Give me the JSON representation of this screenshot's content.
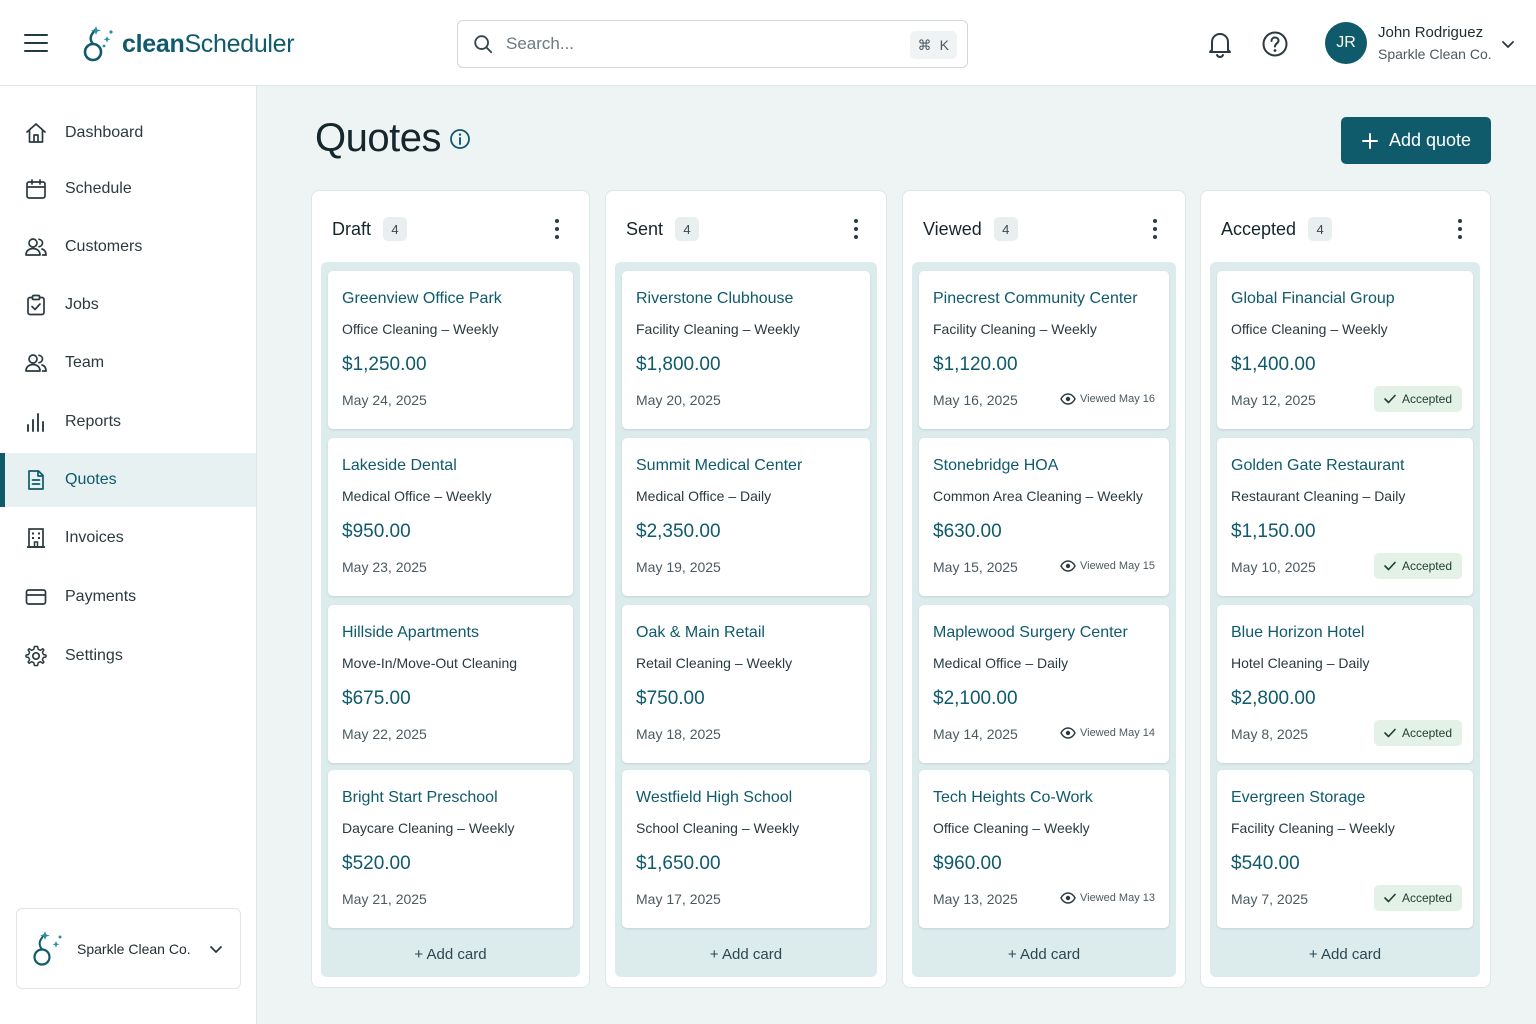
{
  "header": {
    "brand_prefix": "clean",
    "brand_suffix": "Scheduler",
    "search_placeholder": "Search...",
    "search_shortcut_symbol": "⌘",
    "search_shortcut_key": "K",
    "user_initials": "JR",
    "user_name": "John Rodriguez",
    "user_org": "Sparkle Clean Co."
  },
  "sidebar": {
    "items": [
      {
        "label": "Dashboard",
        "icon": "home-icon"
      },
      {
        "label": "Schedule",
        "icon": "calendar-icon"
      },
      {
        "label": "Customers",
        "icon": "users-icon"
      },
      {
        "label": "Jobs",
        "icon": "clipboard-check-icon"
      },
      {
        "label": "Team",
        "icon": "team-icon"
      },
      {
        "label": "Reports",
        "icon": "bar-chart-icon"
      },
      {
        "label": "Quotes",
        "icon": "document-icon",
        "active": true
      },
      {
        "label": "Invoices",
        "icon": "building-icon"
      },
      {
        "label": "Payments",
        "icon": "credit-card-icon"
      },
      {
        "label": "Settings",
        "icon": "gear-icon"
      }
    ],
    "org_switcher": "Sparkle Clean Co."
  },
  "main": {
    "title": "Quotes",
    "add_quote_label": "Add quote",
    "add_card_label": "+ Add card",
    "columns": [
      {
        "title": "Draft",
        "count": "4",
        "cards": [
          {
            "title": "Greenview Office Park",
            "subtitle": "Office Cleaning – Weekly",
            "price": "$1,250.00",
            "date": "May 24, 2025"
          },
          {
            "title": "Lakeside Dental",
            "subtitle": "Medical Office – Weekly",
            "price": "$950.00",
            "date": "May 23, 2025"
          },
          {
            "title": "Hillside Apartments",
            "subtitle": "Move-In/Move-Out Cleaning",
            "price": "$675.00",
            "date": "May 22, 2025"
          },
          {
            "title": "Bright Start Preschool",
            "subtitle": "Daycare Cleaning – Weekly",
            "price": "$520.00",
            "date": "May 21, 2025"
          }
        ]
      },
      {
        "title": "Sent",
        "count": "4",
        "cards": [
          {
            "title": "Riverstone Clubhouse",
            "subtitle": "Facility Cleaning – Weekly",
            "price": "$1,800.00",
            "date": "May 20, 2025"
          },
          {
            "title": "Summit Medical Center",
            "subtitle": "Medical Office – Daily",
            "price": "$2,350.00",
            "date": "May 19, 2025"
          },
          {
            "title": "Oak & Main Retail",
            "subtitle": "Retail Cleaning – Weekly",
            "price": "$750.00",
            "date": "May 18, 2025"
          },
          {
            "title": "Westfield High School",
            "subtitle": "School Cleaning – Weekly",
            "price": "$1,650.00",
            "date": "May 17, 2025"
          }
        ]
      },
      {
        "title": "Viewed",
        "count": "4",
        "cards": [
          {
            "title": "Pinecrest Community Center",
            "subtitle": "Facility Cleaning – Weekly",
            "price": "$1,120.00",
            "date": "May 16, 2025",
            "viewed": "Viewed May 16"
          },
          {
            "title": "Stonebridge HOA",
            "subtitle": "Common Area Cleaning – Weekly",
            "price": "$630.00",
            "date": "May 15, 2025",
            "viewed": "Viewed May 15"
          },
          {
            "title": "Maplewood Surgery Center",
            "subtitle": "Medical Office – Daily",
            "price": "$2,100.00",
            "date": "May 14, 2025",
            "viewed": "Viewed May 14"
          },
          {
            "title": "Tech Heights Co-Work",
            "subtitle": "Office Cleaning – Weekly",
            "price": "$960.00",
            "date": "May 13, 2025",
            "viewed": "Viewed May 13"
          }
        ]
      },
      {
        "title": "Accepted",
        "count": "4",
        "cards": [
          {
            "title": "Global Financial Group",
            "subtitle": "Office Cleaning – Weekly",
            "price": "$1,400.00",
            "date": "May 12, 2025",
            "accepted": "Accepted"
          },
          {
            "title": "Golden Gate Restaurant",
            "subtitle": "Restaurant Cleaning – Daily",
            "price": "$1,150.00",
            "date": "May 10, 2025",
            "accepted": "Accepted"
          },
          {
            "title": "Blue Horizon Hotel",
            "subtitle": "Hotel Cleaning – Daily",
            "price": "$2,800.00",
            "date": "May 8, 2025",
            "accepted": "Accepted"
          },
          {
            "title": "Evergreen Storage",
            "subtitle": "Facility Cleaning – Weekly",
            "price": "$540.00",
            "date": "May 7, 2025",
            "accepted": "Accepted"
          }
        ]
      }
    ]
  },
  "colors": {
    "primary": "#0f5a6b",
    "column_bg": "#dcebec",
    "page_bg": "#eef4f4",
    "accepted_bg": "#e3f1e6"
  }
}
